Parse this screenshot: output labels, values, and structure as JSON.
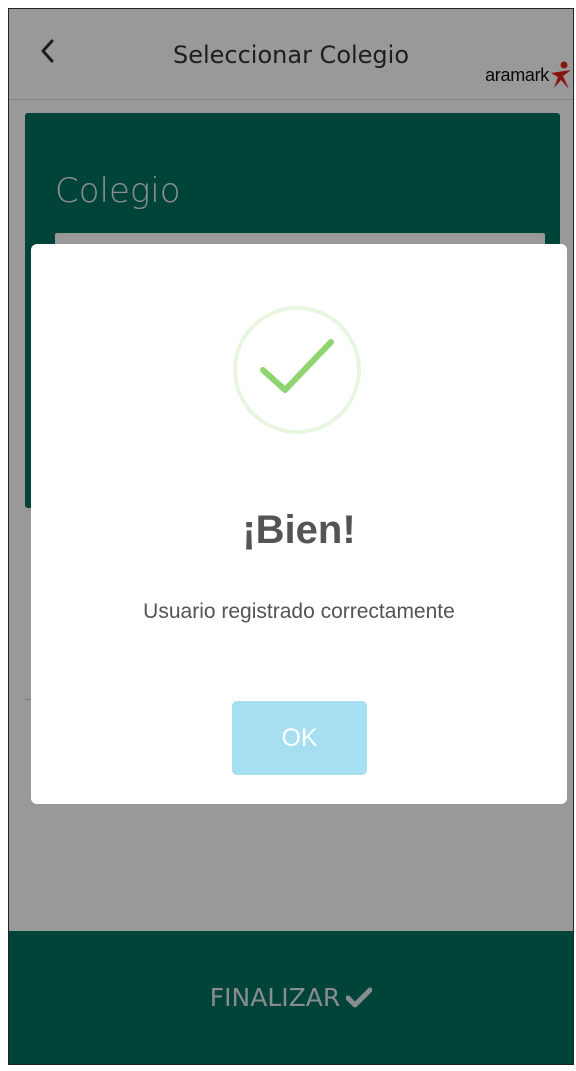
{
  "header": {
    "title": "Seleccionar Colegio",
    "logo_text": "aramark",
    "back_icon": "chevron-left-icon"
  },
  "form": {
    "school_label": "Colegio",
    "school_value": ""
  },
  "footer": {
    "finalize_label": "FINALIZAR",
    "finalize_icon": "check-icon"
  },
  "dialog": {
    "icon": "success-check-icon",
    "title": "¡Bien!",
    "message": "Usuario registrado correctamente",
    "ok_label": "OK"
  },
  "colors": {
    "primary": "#00705f",
    "ok_button": "#a6dff2",
    "success_check": "#8fd46f",
    "logo_accent": "#e2231a"
  }
}
